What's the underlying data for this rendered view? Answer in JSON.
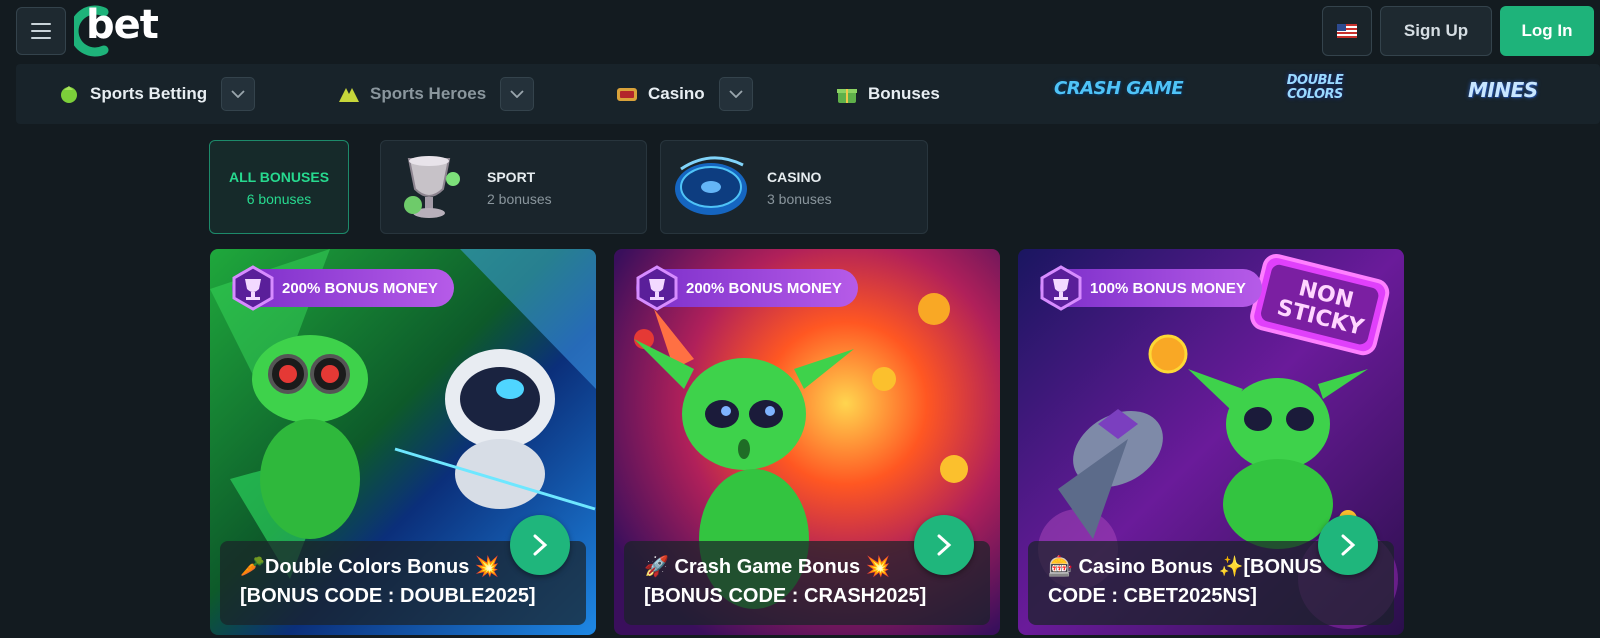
{
  "header": {
    "brand": "bet",
    "signup_label": "Sign Up",
    "login_label": "Log In",
    "language_flag": "us-flag-icon"
  },
  "nav": {
    "items": [
      {
        "label": "Sports Betting",
        "icon": "sports-ball-icon",
        "has_dropdown": true
      },
      {
        "label": "Sports Heroes",
        "icon": "heroes-icon",
        "has_dropdown": true
      },
      {
        "label": "Casino",
        "icon": "slot-icon",
        "has_dropdown": true
      },
      {
        "label": "Bonuses",
        "icon": "gift-icon",
        "has_dropdown": false
      }
    ],
    "games": [
      {
        "label": "CRASH GAME",
        "color": "#4fc3f7"
      },
      {
        "label": "DOUBLE COLORS",
        "color": "#9ad9ff"
      },
      {
        "label": "MINES",
        "color": "#c8e6ff"
      }
    ]
  },
  "filters": [
    {
      "title": "ALL BONUSES",
      "count": "6 bonuses",
      "active": true
    },
    {
      "title": "SPORT",
      "count": "2 bonuses",
      "active": false
    },
    {
      "title": "CASINO",
      "count": "3 bonuses",
      "active": false
    }
  ],
  "cards": [
    {
      "badge": "200% BONUS MONEY",
      "title_line1": "🥕Double Colors Bonus 💥",
      "title_line2": "[BONUS CODE : DOUBLE2025]"
    },
    {
      "badge": "200% BONUS MONEY",
      "title_line1": "🚀 Crash Game Bonus 💥",
      "title_line2": "[BONUS CODE : CRASH2025]"
    },
    {
      "badge": "100% BONUS MONEY",
      "title_line1": "🎰 Casino Bonus ✨[BONUS",
      "title_line2": "CODE : CBET2025NS]",
      "sticker": "NON STICKY"
    }
  ],
  "colors": {
    "accent_green": "#1eb37a",
    "badge_purple": "#9b45d8",
    "background": "#131b20"
  }
}
